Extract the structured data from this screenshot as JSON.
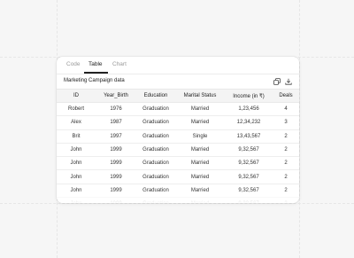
{
  "tabs": [
    {
      "label": "Code",
      "active": false
    },
    {
      "label": "Table",
      "active": true
    },
    {
      "label": "Chart",
      "active": false
    }
  ],
  "panel": {
    "title": "Marketing Campaign data",
    "icons": [
      "copy-icon",
      "download-icon"
    ]
  },
  "table": {
    "columns": [
      "ID",
      "Year_Birth",
      "Education",
      "Marital Status",
      "Income (in ₹)",
      "Deals"
    ],
    "rows": [
      [
        "Robert",
        "1976",
        "Graduation",
        "Married",
        "1,23,456",
        "4"
      ],
      [
        "Alex",
        "1987",
        "Graduation",
        "Married",
        "12,34,232",
        "3"
      ],
      [
        "Brit",
        "1997",
        "Graduation",
        "Single",
        "13,43,567",
        "2"
      ],
      [
        "John",
        "1999",
        "Graduation",
        "Married",
        "9,32,567",
        "2"
      ],
      [
        "John",
        "1999",
        "Graduation",
        "Married",
        "9,32,567",
        "2"
      ],
      [
        "John",
        "1999",
        "Graduation",
        "Married",
        "9,32,567",
        "2"
      ],
      [
        "John",
        "1999",
        "Graduation",
        "Married",
        "9,32,567",
        "2"
      ],
      [
        "John",
        "1999",
        "Graduation",
        "Married",
        "9,32,567",
        "2"
      ]
    ]
  },
  "colors": {
    "accent": "#222222",
    "header_bg": "#f4f4f4",
    "page_bg": "#f6f6f6"
  }
}
